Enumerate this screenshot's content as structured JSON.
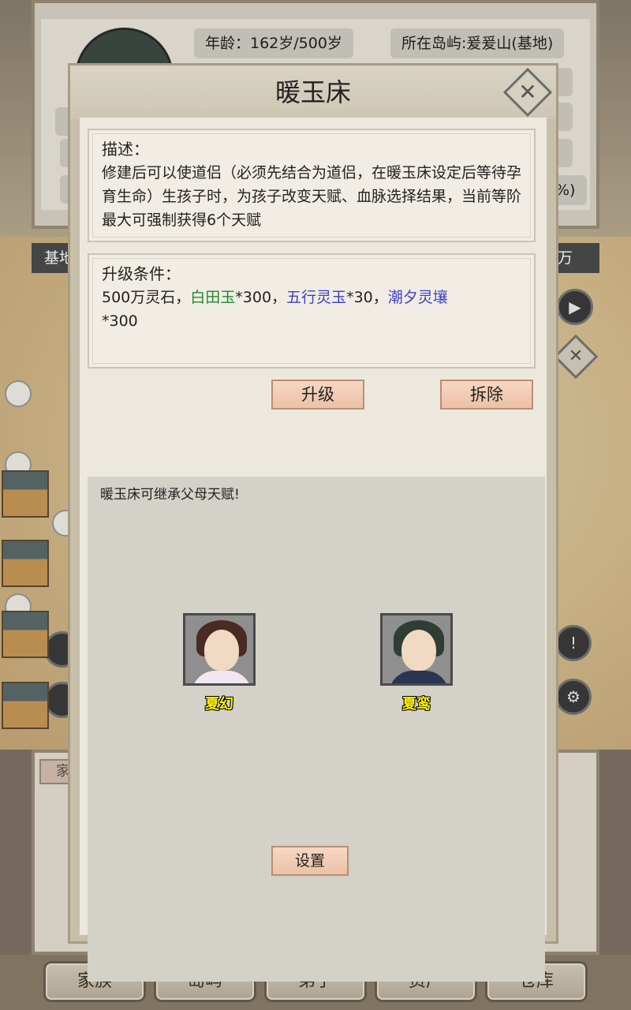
{
  "background": {
    "age_label": "年龄：162岁/500岁",
    "location_label": "所在岛屿:爰爰山(基地)",
    "percent_fragment": "%)",
    "map_header_left": "基地",
    "map_header_right": "万",
    "lower_tab": "家"
  },
  "dialog": {
    "title": "暖玉床",
    "close_symbol": "✕",
    "description": {
      "heading": "描述：",
      "text": "修建后可以使道侣（必须先结合为道侣，在暖玉床设定后等待孕育生命）生孩子时，为孩子改变天赋、血脉选择结果，当前等阶最大可强制获得6个天赋"
    },
    "upgrade_conditions": {
      "heading": "升级条件：",
      "part1": "500万灵石，",
      "item1": "白田玉",
      "qty1": "*300，",
      "item2": "五行灵玉",
      "qty2": "*30，",
      "item3": "潮夕灵壤",
      "qty3": "*300"
    },
    "upgrade_button": "升级",
    "demolish_button": "拆除",
    "inherit_note": "暖玉床可继承父母天赋!",
    "parents": [
      {
        "name": "夏幻"
      },
      {
        "name": "夏鸾"
      }
    ],
    "setting_button": "设置"
  },
  "bottom_nav": [
    {
      "label": "家族"
    },
    {
      "label": "岛屿"
    },
    {
      "label": "弟子"
    },
    {
      "label": "资产"
    },
    {
      "label": "仓库"
    }
  ],
  "colors": {
    "green_item": "#1f8a2a",
    "blue_item": "#3c3fc4",
    "parent_name": "#fff200",
    "button_peach": "#ecc1a6"
  }
}
